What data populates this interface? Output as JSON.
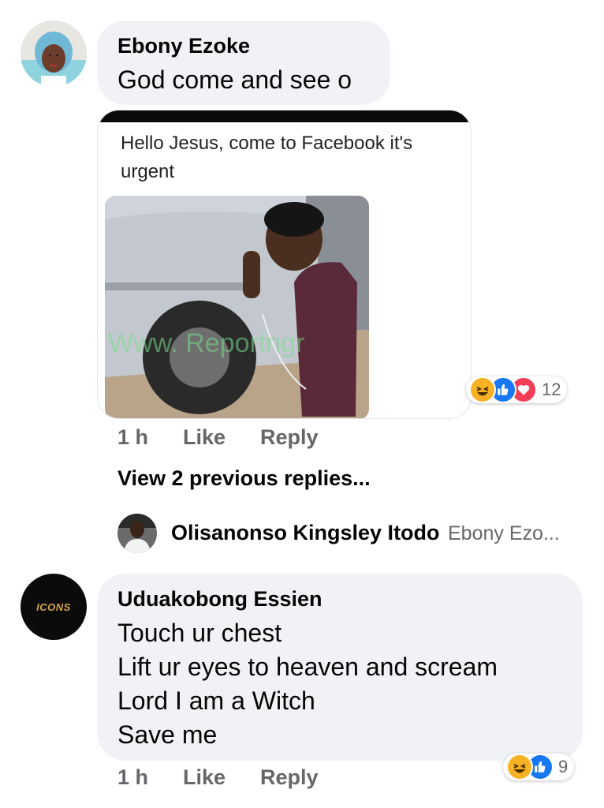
{
  "comment1": {
    "author": "Ebony Ezoke",
    "text": "God come and see o",
    "meme": {
      "caption": "Hello Jesus,  come to Facebook it's urgent",
      "watermark": "Www. Reportngr"
    },
    "reactions": {
      "icons": [
        "haha-icon",
        "like-icon",
        "love-icon"
      ],
      "count": "12"
    },
    "time": "1 h",
    "like_label": "Like",
    "reply_label": "Reply"
  },
  "view_previous": "View 2 previous replies...",
  "reply_preview": {
    "author": "Olisanonso Kingsley Itodo",
    "snippet": "Ebony Ezo..."
  },
  "comment2": {
    "author": "Uduakobong Essien",
    "avatar_text": "ICONS",
    "lines": [
      "Touch ur chest",
      "Lift ur eyes to heaven and scream",
      "Lord I am a Witch",
      "Save me"
    ],
    "reactions": {
      "icons": [
        "haha-icon",
        "like-icon"
      ],
      "count": "9"
    },
    "time": "1 h",
    "like_label": "Like",
    "reply_label": "Reply"
  },
  "colors": {
    "bubble": "#f0f2f5",
    "meta_gray": "#65676b",
    "like_blue": "#1877f2",
    "love_red": "#f33e58",
    "haha_yellow": "#f7b125"
  }
}
